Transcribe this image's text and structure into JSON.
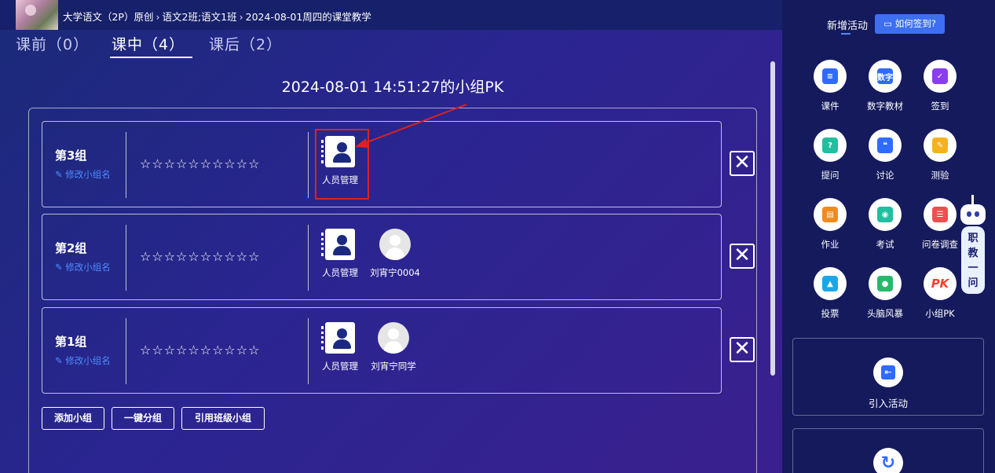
{
  "breadcrumb": {
    "course": "大学语文（2P）原创",
    "classes": "语文2班;语文1班",
    "session": "2024-08-01周四的课堂教学",
    "sep": "›"
  },
  "tabs": [
    {
      "label": "课前（0）"
    },
    {
      "label": "课中（4）"
    },
    {
      "label": "课后（2）"
    }
  ],
  "session_title": "2024-08-01 14:51:27的小组PK",
  "rename_label": "✎ 修改小组名",
  "stars": "☆☆☆☆☆☆☆☆☆☆",
  "groups": [
    {
      "name": "第3组",
      "members": [
        {
          "type": "book",
          "label": "人员管理"
        }
      ]
    },
    {
      "name": "第2组",
      "members": [
        {
          "type": "book",
          "label": "人员管理"
        },
        {
          "type": "avatar",
          "label": "刘宵宁0004"
        }
      ]
    },
    {
      "name": "第1组",
      "members": [
        {
          "type": "book",
          "label": "人员管理"
        },
        {
          "type": "avatar",
          "label": "刘宵宁同学"
        }
      ]
    }
  ],
  "close_glyph": "✕",
  "buttons": {
    "add_group": "添加小组",
    "auto_group": "一键分组",
    "cite_class_group": "引用班级小组"
  },
  "sidebar": {
    "title": "新增活动",
    "howto": "▭ 如何签到?",
    "activities": [
      {
        "label": "课件",
        "icon": "courseware-icon",
        "color": "#2f6bff",
        "glyph": "≡"
      },
      {
        "label": "数字教材",
        "icon": "digital-textbook-icon",
        "color": "#2f6bff",
        "glyph": "数字"
      },
      {
        "label": "签到",
        "icon": "checkin-icon",
        "color": "#8b3bf0",
        "glyph": "✓"
      },
      {
        "label": "提问",
        "icon": "question-icon",
        "color": "#1fbf9f",
        "glyph": "?"
      },
      {
        "label": "讨论",
        "icon": "discussion-icon",
        "color": "#2f6bff",
        "glyph": "❝"
      },
      {
        "label": "测验",
        "icon": "quiz-icon",
        "color": "#f5b21c",
        "glyph": "✎"
      },
      {
        "label": "作业",
        "icon": "homework-icon",
        "color": "#f28a1c",
        "glyph": "▤"
      },
      {
        "label": "考试",
        "icon": "exam-icon",
        "color": "#1fbf9f",
        "glyph": "◉"
      },
      {
        "label": "问卷调查",
        "icon": "survey-icon",
        "color": "#f04e4e",
        "glyph": "☰"
      },
      {
        "label": "投票",
        "icon": "vote-icon",
        "color": "#1aa7e8",
        "glyph": "▲"
      },
      {
        "label": "头脑风暴",
        "icon": "brainstorm-icon",
        "color": "#27b86a",
        "glyph": "●"
      },
      {
        "label": "小组PK",
        "icon": "group-pk-icon",
        "color": "#f0412e",
        "glyph": "PK"
      }
    ],
    "import_label": "引入活动",
    "robot_text": "职教一问"
  },
  "colors": {
    "accent": "#4e8cff",
    "highlight": "#e02020",
    "sidebar_bg": "#141a5c"
  }
}
